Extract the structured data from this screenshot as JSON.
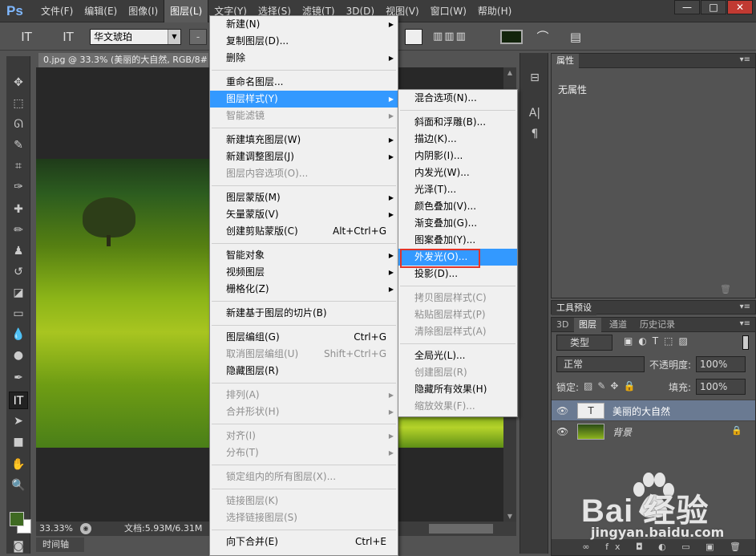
{
  "app": {
    "logo": "Ps"
  },
  "menubar": {
    "items": [
      "文件(F)",
      "编辑(E)",
      "图像(I)",
      "图层(L)",
      "文字(Y)",
      "选择(S)",
      "滤镜(T)",
      "3D(D)",
      "视图(V)",
      "窗口(W)",
      "帮助(H)"
    ],
    "active_index": 3
  },
  "window_controls": {
    "minimize": "—",
    "restore": "□",
    "close": "✕"
  },
  "options_bar": {
    "font_family": "华文琥珀",
    "font_style": "-",
    "text_color": "#13240c"
  },
  "document": {
    "tab_title": "0.jpg @ 33.3% (美丽的大自然, RGB/8#",
    "zoom": "33.33%",
    "doc_size": "文档:5.93M/6.31M"
  },
  "timeline_tab": "时间轴",
  "properties_panel": {
    "tab": "属性",
    "empty_text": "无属性"
  },
  "tool_presets_panel": {
    "tab": "工具预设"
  },
  "layers_panel": {
    "tabs": [
      "3D",
      "图层",
      "通道",
      "历史记录"
    ],
    "active_tab": "图层",
    "filter_kind": "类型",
    "blend_mode": "正常",
    "opacity_label": "不透明度:",
    "opacity": "100%",
    "lock_label": "锁定:",
    "fill_label": "填充:",
    "fill": "100%",
    "layers": [
      {
        "name": "美丽的大自然",
        "type": "text",
        "selected": true
      },
      {
        "name": "背景",
        "type": "image",
        "selected": false
      }
    ]
  },
  "layer_menu": {
    "items": [
      {
        "label": "新建(N)",
        "submenu": true
      },
      {
        "label": "复制图层(D)..."
      },
      {
        "label": "删除",
        "submenu": true
      },
      {
        "sep": true
      },
      {
        "label": "重命名图层..."
      },
      {
        "label": "图层样式(Y)",
        "submenu": true,
        "highlighted": true
      },
      {
        "label": "智能滤镜",
        "submenu": true,
        "disabled": true
      },
      {
        "sep": true
      },
      {
        "label": "新建填充图层(W)",
        "submenu": true
      },
      {
        "label": "新建调整图层(J)",
        "submenu": true
      },
      {
        "label": "图层内容选项(O)...",
        "disabled": true
      },
      {
        "sep": true
      },
      {
        "label": "图层蒙版(M)",
        "submenu": true
      },
      {
        "label": "矢量蒙版(V)",
        "submenu": true
      },
      {
        "label": "创建剪贴蒙版(C)",
        "shortcut": "Alt+Ctrl+G"
      },
      {
        "sep": true
      },
      {
        "label": "智能对象",
        "submenu": true
      },
      {
        "label": "视频图层",
        "submenu": true
      },
      {
        "label": "栅格化(Z)",
        "submenu": true
      },
      {
        "sep": true
      },
      {
        "label": "新建基于图层的切片(B)"
      },
      {
        "sep": true
      },
      {
        "label": "图层编组(G)",
        "shortcut": "Ctrl+G"
      },
      {
        "label": "取消图层编组(U)",
        "shortcut": "Shift+Ctrl+G",
        "disabled": true
      },
      {
        "label": "隐藏图层(R)"
      },
      {
        "sep": true
      },
      {
        "label": "排列(A)",
        "submenu": true,
        "disabled": true
      },
      {
        "label": "合并形状(H)",
        "submenu": true,
        "disabled": true
      },
      {
        "sep": true
      },
      {
        "label": "对齐(I)",
        "submenu": true,
        "disabled": true
      },
      {
        "label": "分布(T)",
        "submenu": true,
        "disabled": true
      },
      {
        "sep": true
      },
      {
        "label": "锁定组内的所有图层(X)...",
        "disabled": true
      },
      {
        "sep": true
      },
      {
        "label": "链接图层(K)",
        "disabled": true
      },
      {
        "label": "选择链接图层(S)",
        "disabled": true
      },
      {
        "sep": true
      },
      {
        "label": "向下合并(E)",
        "shortcut": "Ctrl+E"
      }
    ]
  },
  "layer_style_submenu": {
    "items": [
      {
        "label": "混合选项(N)..."
      },
      {
        "sep": true
      },
      {
        "label": "斜面和浮雕(B)..."
      },
      {
        "label": "描边(K)..."
      },
      {
        "label": "内阴影(I)..."
      },
      {
        "label": "内发光(W)..."
      },
      {
        "label": "光泽(T)..."
      },
      {
        "label": "颜色叠加(V)..."
      },
      {
        "label": "渐变叠加(G)..."
      },
      {
        "label": "图案叠加(Y)..."
      },
      {
        "label": "外发光(O)...",
        "highlighted": true
      },
      {
        "label": "投影(D)..."
      },
      {
        "sep": true
      },
      {
        "label": "拷贝图层样式(C)",
        "disabled": true
      },
      {
        "label": "粘贴图层样式(P)",
        "disabled": true
      },
      {
        "label": "清除图层样式(A)",
        "disabled": true
      },
      {
        "sep": true
      },
      {
        "label": "全局光(L)..."
      },
      {
        "label": "创建图层(R)",
        "disabled": true
      },
      {
        "label": "隐藏所有效果(H)"
      },
      {
        "label": "缩放效果(F)...",
        "disabled": true
      }
    ]
  },
  "watermark": {
    "logo": "Bai  经验",
    "url": "jingyan.baidu.com"
  },
  "colors": {
    "accent_highlight": "#3399ff",
    "callout_box": "#e0342a",
    "foreground": "#3f6a22",
    "background": "#ffffff"
  }
}
